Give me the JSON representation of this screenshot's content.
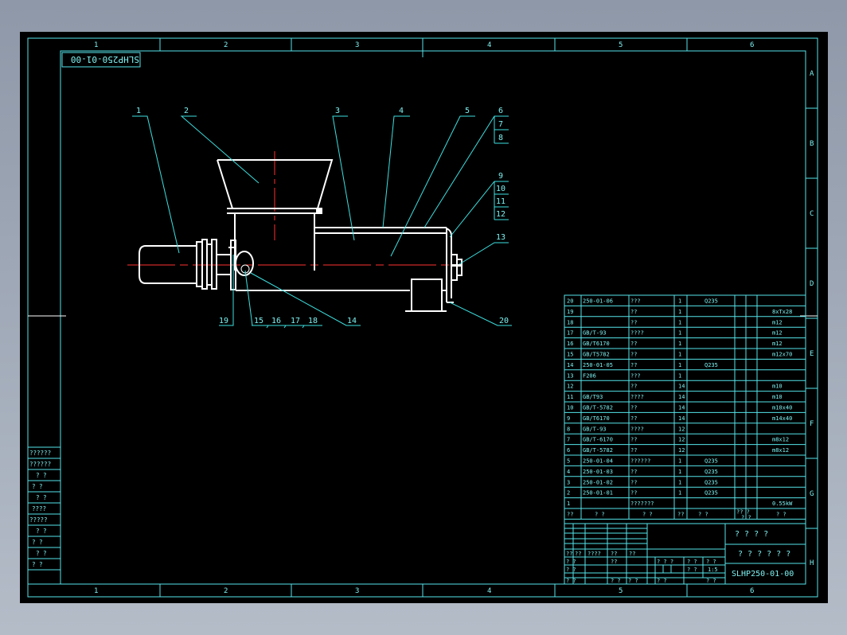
{
  "drawing": {
    "top_code": "SLHP250-01-00",
    "drawing_no": "SLHP250-01-00",
    "column_markers": [
      "1",
      "2",
      "3",
      "4",
      "5",
      "6"
    ],
    "row_markers": [
      "A",
      "B",
      "C",
      "D",
      "E",
      "F",
      "G",
      "H"
    ],
    "title_line1": "? ? ? ?",
    "title_line2": "? ? ? ? ? ?",
    "scale": "1:5"
  },
  "callouts": [
    "1",
    "2",
    "3",
    "4",
    "5",
    "6",
    "7",
    "8",
    "9",
    "10",
    "11",
    "12",
    "13",
    "14",
    "15",
    "16",
    "17",
    "18",
    "19",
    "20"
  ],
  "bom": [
    {
      "no": "20",
      "code": "250-01-06",
      "name": "???",
      "qty": "1",
      "mat": "Q235",
      "note": ""
    },
    {
      "no": "19",
      "code": "",
      "name": "??",
      "qty": "1",
      "mat": "",
      "note": "8xTx28"
    },
    {
      "no": "18",
      "code": "",
      "name": "??",
      "qty": "1",
      "mat": "",
      "note": "m12"
    },
    {
      "no": "17",
      "code": "GB/T-93",
      "name": "????",
      "qty": "1",
      "mat": "",
      "note": "m12"
    },
    {
      "no": "16",
      "code": "GB/T6170",
      "name": "??",
      "qty": "1",
      "mat": "",
      "note": "m12"
    },
    {
      "no": "15",
      "code": "GB/T5782",
      "name": "??",
      "qty": "1",
      "mat": "",
      "note": "m12x70"
    },
    {
      "no": "14",
      "code": "250-01-05",
      "name": "??",
      "qty": "1",
      "mat": "Q235",
      "note": ""
    },
    {
      "no": "13",
      "code": "F206",
      "name": "???",
      "qty": "1",
      "mat": "",
      "note": ""
    },
    {
      "no": "12",
      "code": "",
      "name": "??",
      "qty": "14",
      "mat": "",
      "note": "m10"
    },
    {
      "no": "11",
      "code": "GB/T93",
      "name": "????",
      "qty": "14",
      "mat": "",
      "note": "m10"
    },
    {
      "no": "10",
      "code": "GB/T-5782",
      "name": "??",
      "qty": "14",
      "mat": "",
      "note": "m10x40"
    },
    {
      "no": "9",
      "code": "GB/T6170",
      "name": "??",
      "qty": "14",
      "mat": "",
      "note": "m14x40"
    },
    {
      "no": "8",
      "code": "GB/T-93",
      "name": "????",
      "qty": "12",
      "mat": "",
      "note": ""
    },
    {
      "no": "7",
      "code": "GB/T-6170",
      "name": "??",
      "qty": "12",
      "mat": "",
      "note": "m8x12"
    },
    {
      "no": "6",
      "code": "GB/T-5782",
      "name": "??",
      "qty": "12",
      "mat": "",
      "note": "m8x12"
    },
    {
      "no": "5",
      "code": "250-01-04",
      "name": "??????",
      "qty": "1",
      "mat": "Q235",
      "note": ""
    },
    {
      "no": "4",
      "code": "250-01-03",
      "name": "??",
      "qty": "1",
      "mat": "Q235",
      "note": ""
    },
    {
      "no": "3",
      "code": "250-01-02",
      "name": "??",
      "qty": "1",
      "mat": "Q235",
      "note": ""
    },
    {
      "no": "2",
      "code": "250-01-01",
      "name": "??",
      "qty": "1",
      "mat": "Q235",
      "note": ""
    },
    {
      "no": "1",
      "code": "",
      "name": "???????",
      "qty": "",
      "mat": "",
      "note": "0.55kW"
    }
  ],
  "bom_header": {
    "no": "??",
    "code": "? ?",
    "name": "? ?",
    "qty": "??",
    "mat": "? ?",
    "w1": "?? ?",
    "w2": "? ?",
    "note": "? ?"
  },
  "side_block": [
    "??????",
    "??????",
    "? ?",
    "? ?",
    "? ?",
    "????",
    "?????",
    "? ?",
    "? ?",
    "? ?",
    "? ?"
  ],
  "title_small": {
    "r1": [
      "??",
      "??",
      "????",
      "??",
      "??"
    ],
    "r2": [
      "? ?",
      "??",
      "? ? ?",
      "? ?",
      "? ?"
    ],
    "r3": [
      "? ?",
      "? ?",
      "? ?"
    ],
    "r4": [
      "? ?",
      "? ?",
      "? ?",
      "? ?",
      "? ?"
    ]
  }
}
